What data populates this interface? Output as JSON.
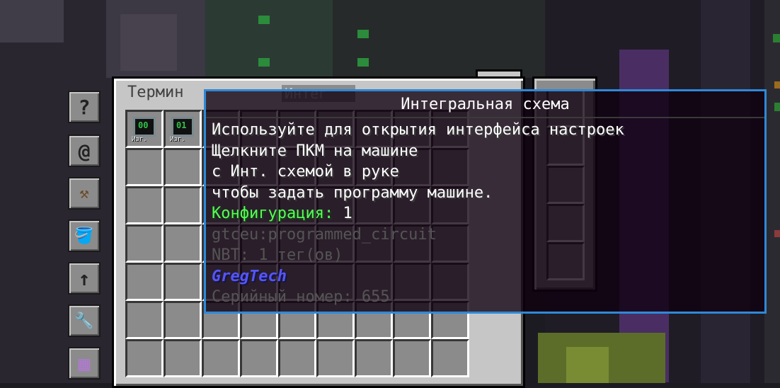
{
  "panel": {
    "title": "Термин",
    "tab2_title": "Интег"
  },
  "side_tabs": [
    {
      "name": "help",
      "glyph": "?"
    },
    {
      "name": "email",
      "glyph": "@"
    },
    {
      "name": "hammer",
      "glyph": "⚒"
    },
    {
      "name": "bucket",
      "glyph": "🪣"
    },
    {
      "name": "upload",
      "glyph": "↑"
    },
    {
      "name": "wrench",
      "glyph": "🔧"
    },
    {
      "name": "storage",
      "glyph": "▦"
    }
  ],
  "inventory": {
    "items": [
      {
        "number": "00",
        "tag": "Изг."
      },
      {
        "number": "01",
        "tag": "Изг."
      }
    ]
  },
  "tooltip": {
    "title": "Интегральная схема",
    "lines": [
      "Используйте для открытия интерфейса настроек",
      "Щелкните ПКМ на машине",
      "с Инт. схемой в руке",
      "чтобы задать программу машине."
    ],
    "config_label": "Конфигурация:",
    "config_value": "1",
    "id": "gtceu:programmed_circuit",
    "nbt": "NBT: 1 тег(ов)",
    "mod": "GregTech",
    "serial": "Серийный номер: 655"
  },
  "colors": {
    "tooltip_border": "#2e89d9",
    "config_green": "#55ff55",
    "mod_blue": "#5555ff"
  }
}
